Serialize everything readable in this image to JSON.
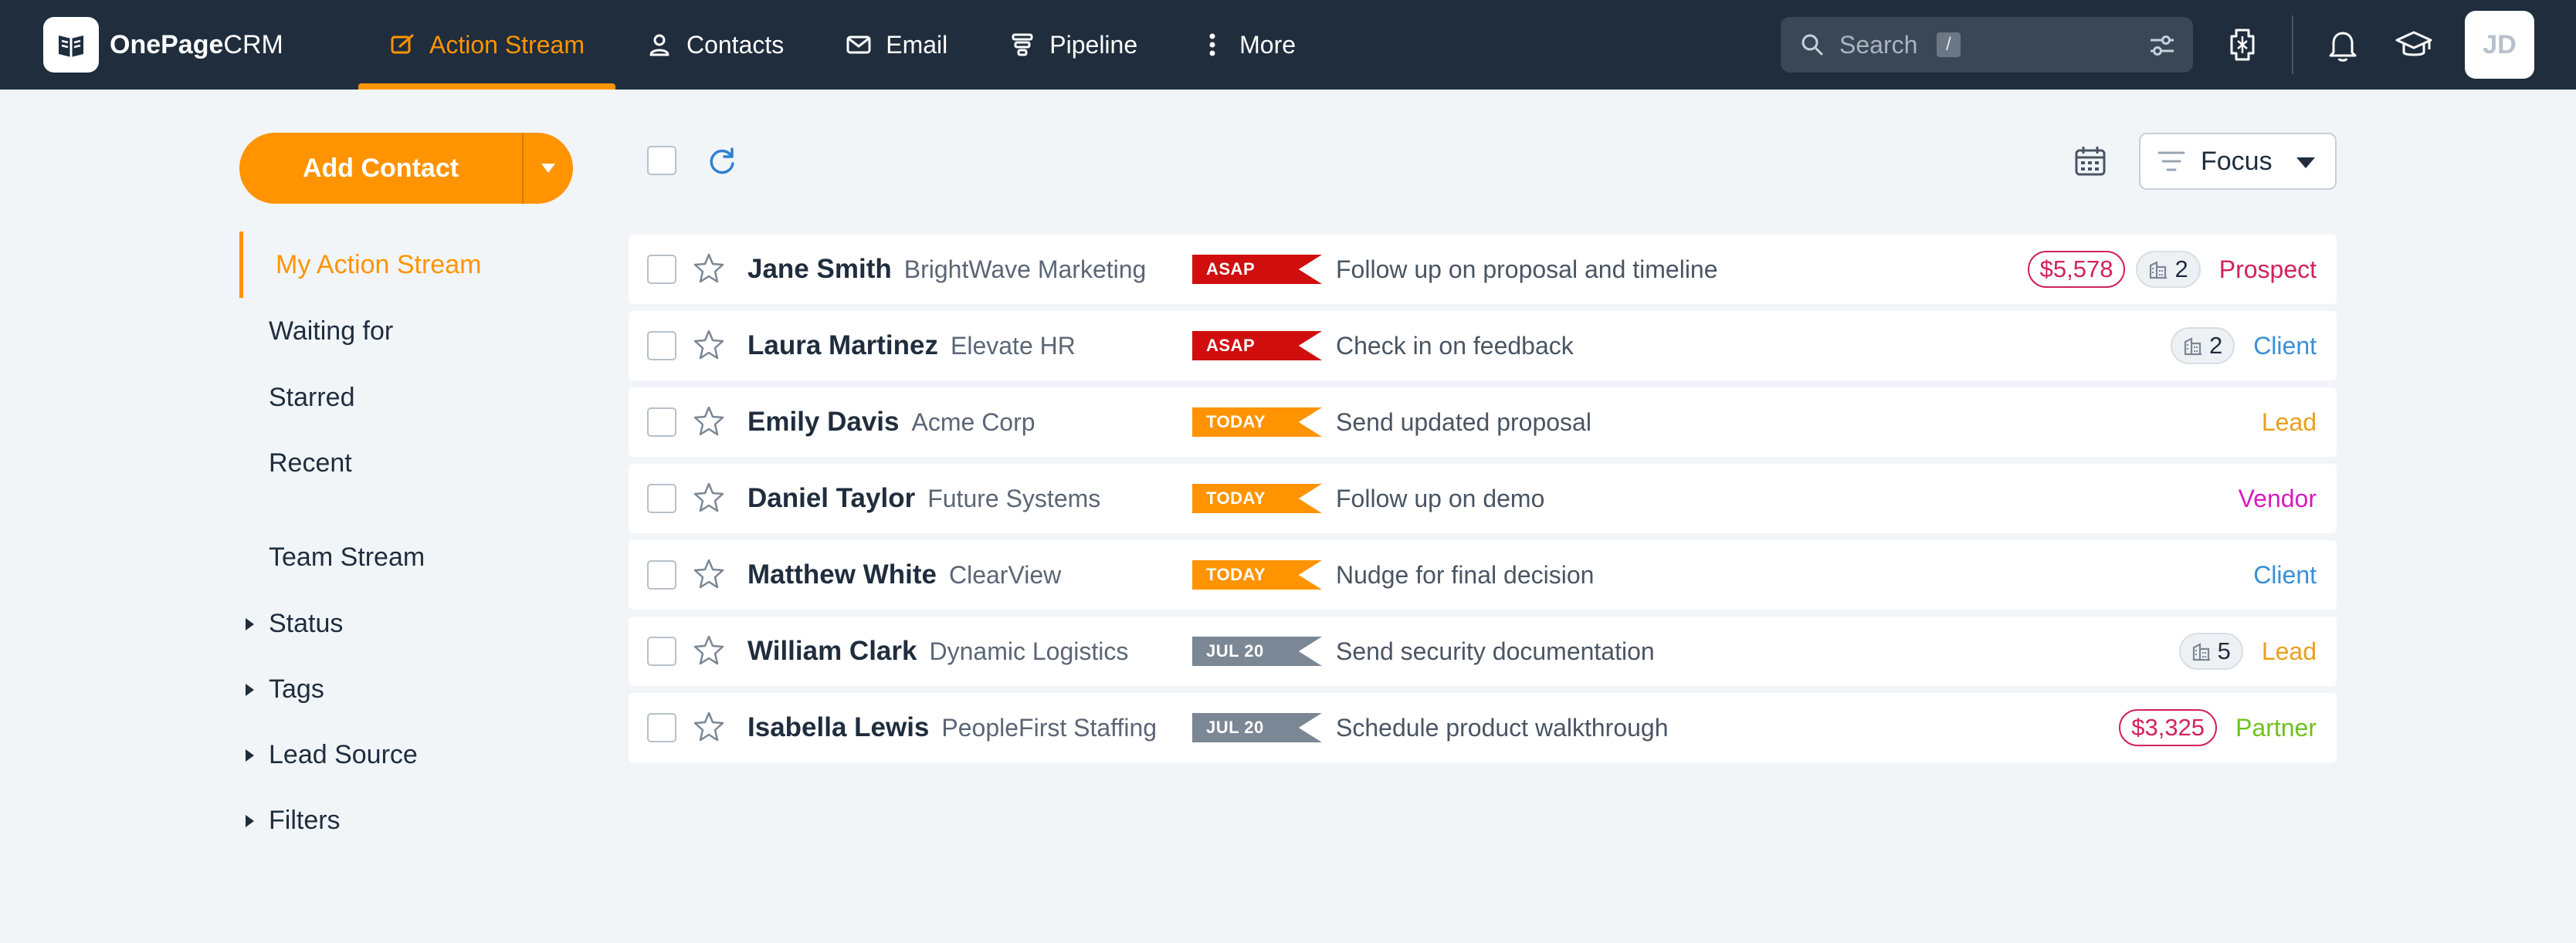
{
  "brand": {
    "bold": "OnePage",
    "light": "CRM"
  },
  "nav": {
    "items": [
      {
        "label": "Action Stream",
        "icon": "action-stream-icon",
        "active": true
      },
      {
        "label": "Contacts",
        "icon": "person-icon"
      },
      {
        "label": "Email",
        "icon": "envelope-icon"
      },
      {
        "label": "Pipeline",
        "icon": "funnel-icon"
      },
      {
        "label": "More",
        "icon": "kebab-icon"
      }
    ]
  },
  "search": {
    "placeholder": "Search",
    "shortcut": "/"
  },
  "user": {
    "initials": "JD"
  },
  "sidebar": {
    "add_contact": "Add Contact",
    "items": [
      {
        "label": "My Action Stream",
        "active": true
      },
      {
        "label": "Waiting for"
      },
      {
        "label": "Starred"
      },
      {
        "label": "Recent"
      },
      {
        "label": "Team Stream"
      },
      {
        "label": "Status",
        "expandable": true
      },
      {
        "label": "Tags",
        "expandable": true
      },
      {
        "label": "Lead Source",
        "expandable": true
      },
      {
        "label": "Filters",
        "expandable": true
      }
    ]
  },
  "toolbar": {
    "focus_label": "Focus"
  },
  "colors": {
    "accent": "#ff9400",
    "asap": "#d00e0e",
    "date": "#7b8794",
    "deal": "#d1225b",
    "prospect": "#d1225b",
    "client": "#3a8fd6",
    "lead": "#e8a01c",
    "vendor": "#d81bbd",
    "partner": "#6fc21d"
  },
  "rows": [
    {
      "name": "Jane Smith",
      "company": "BrightWave Marketing",
      "badge": "ASAP",
      "badge_type": "asap",
      "action": "Follow up on proposal and timeline",
      "deal": "$5,578",
      "count": "2",
      "status": "Prospect",
      "status_color": "#d1225b"
    },
    {
      "name": "Laura Martinez",
      "company": "Elevate HR",
      "badge": "ASAP",
      "badge_type": "asap",
      "action": "Check in on feedback",
      "count": "2",
      "status": "Client",
      "status_color": "#3a8fd6"
    },
    {
      "name": "Emily Davis",
      "company": "Acme Corp",
      "badge": "TODAY",
      "badge_type": "today",
      "action": "Send updated proposal",
      "status": "Lead",
      "status_color": "#e8a01c"
    },
    {
      "name": "Daniel Taylor",
      "company": "Future Systems",
      "badge": "TODAY",
      "badge_type": "today",
      "action": "Follow up on demo",
      "status": "Vendor",
      "status_color": "#d81bbd"
    },
    {
      "name": "Matthew White",
      "company": "ClearView",
      "badge": "TODAY",
      "badge_type": "today",
      "action": "Nudge for final decision",
      "status": "Client",
      "status_color": "#3a8fd6"
    },
    {
      "name": "William Clark",
      "company": "Dynamic Logistics",
      "badge": "JUL 20",
      "badge_type": "date",
      "action": "Send security documentation",
      "count": "5",
      "status": "Lead",
      "status_color": "#e8a01c"
    },
    {
      "name": "Isabella Lewis",
      "company": "PeopleFirst Staffing",
      "badge": "JUL 20",
      "badge_type": "date",
      "action": "Schedule product walkthrough",
      "deal": "$3,325",
      "status": "Partner",
      "status_color": "#6fc21d"
    }
  ]
}
